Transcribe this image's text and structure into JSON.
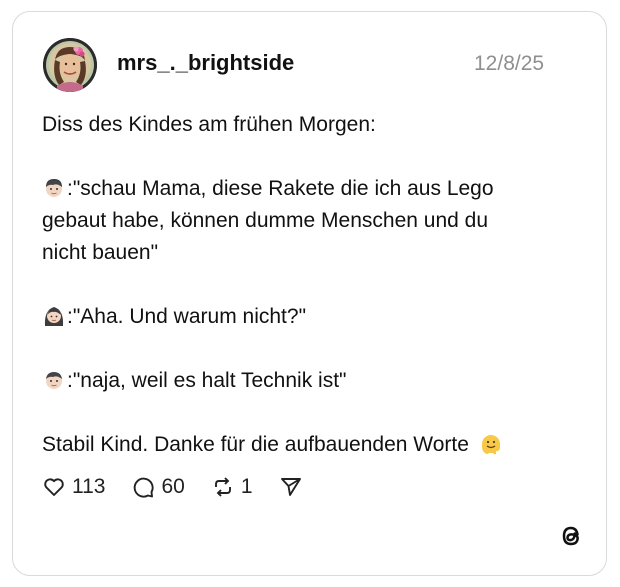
{
  "post": {
    "username": "mrs_._brightside",
    "date": "12/8/25",
    "lines": {
      "l1": "Diss des Kindes am frühen Morgen:",
      "l2a": ":\"schau Mama, diese Rakete die ich aus Lego",
      "l2b": "gebaut habe, können dumme Menschen und du",
      "l2c": "nicht bauen\"",
      "l3": ":\"Aha. Und warum nicht?\"",
      "l4": ":\"naja, weil es halt Technik ist\"",
      "l5": "Stabil Kind. Danke für die aufbauenden Worte"
    },
    "emoji_names": [
      "boy-emoji",
      "woman-emoji",
      "boy-emoji",
      "melting-face-emoji"
    ]
  },
  "actions": {
    "likes": "113",
    "comments": "60",
    "reposts": "1"
  },
  "icons": {
    "like": "heart-icon",
    "comment": "comment-icon",
    "repost": "repost-icon",
    "share": "send-icon",
    "brand": "threads-logo-icon"
  }
}
